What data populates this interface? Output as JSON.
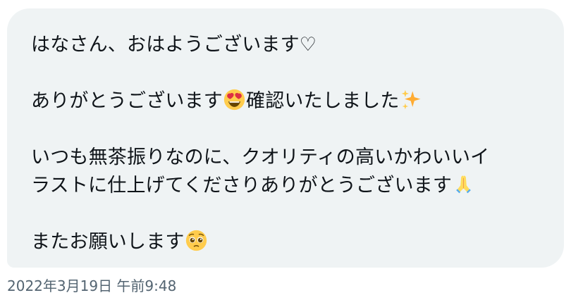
{
  "message": {
    "line1": "はなさん、おはようございます♡",
    "line2_text": "ありがとうございます",
    "line2_after_emoji": "確認いたしました",
    "line3": "いつも無茶振りなのに、クオリティの高いかわいいイ",
    "line4": "ラストに仕上げてくださりありがとうございます",
    "line5": "またお願いします",
    "emojis": {
      "heart_eyes": "smiling-face-with-heart-eyes",
      "sparkles": "sparkles",
      "folded_hands": "folded-hands",
      "pleading": "pleading-face"
    }
  },
  "timestamp": "2022年3月19日 午前9:48",
  "colors": {
    "bubble_bg": "#eff3f4",
    "text": "#0f1419",
    "timestamp": "#536471"
  }
}
